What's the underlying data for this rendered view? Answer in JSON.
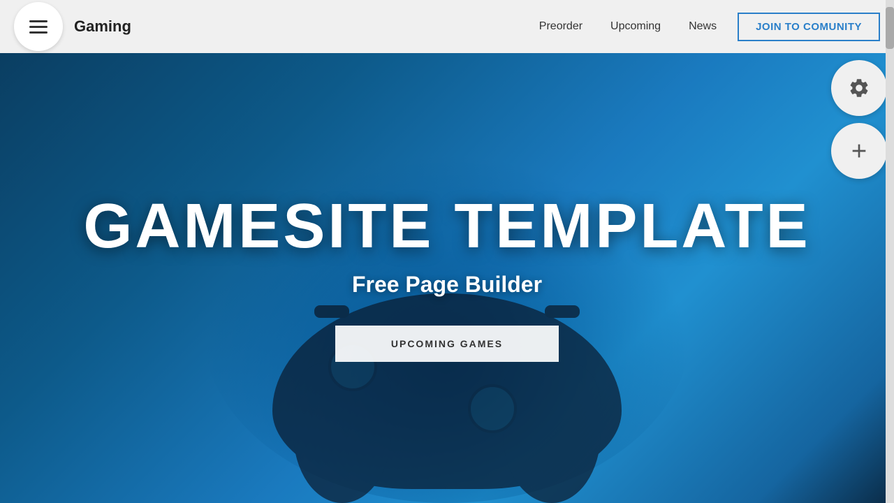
{
  "header": {
    "logo": "Gaming",
    "nav": {
      "preorder": "Preorder",
      "upcoming": "Upcoming",
      "news": "News",
      "join_button": "JOIN TO COMUNITY"
    }
  },
  "hero": {
    "title": "GAMESITE TEMPLATE",
    "subtitle": "Free Page Builder",
    "cta_button": "UPCOMING GAMES"
  },
  "floating": {
    "settings_icon": "⚙",
    "add_icon": "+"
  },
  "icons": {
    "menu": "menu-icon",
    "gear": "gear-icon",
    "plus": "plus-icon"
  }
}
